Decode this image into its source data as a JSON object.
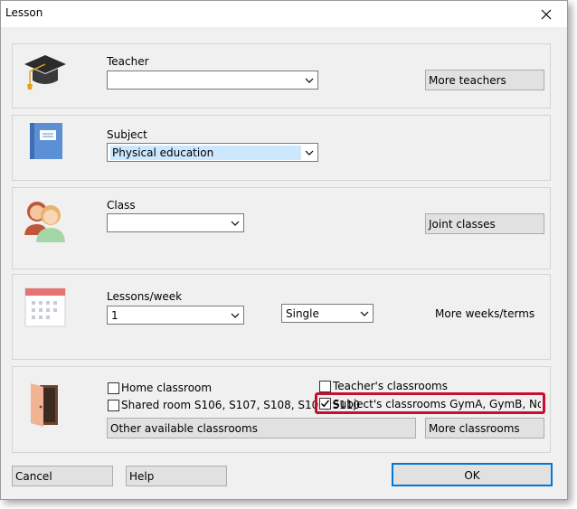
{
  "window": {
    "title": "Lesson"
  },
  "teacher": {
    "label": "Teacher",
    "value": "",
    "more_button": "More teachers"
  },
  "subject": {
    "label": "Subject",
    "value": "Physical education"
  },
  "class": {
    "label": "Class",
    "value": "",
    "joint_button": "Joint classes"
  },
  "lessons": {
    "label": "Lessons/week",
    "count": "1",
    "type": "Single",
    "more_weeks": "More weeks/terms"
  },
  "rooms": {
    "home_classroom": {
      "label": "Home classroom",
      "checked": false
    },
    "shared_room": {
      "label": "Shared room S106, S107, S108, S109, S110",
      "checked": false
    },
    "teachers_classrooms": {
      "label": "Teacher's classrooms",
      "checked": false
    },
    "subjects_classrooms": {
      "label": "Subject's classrooms GymA, GymB, Normal:Gy",
      "checked": true
    },
    "other_available": "Other available classrooms",
    "more_classrooms": "More classrooms",
    "highlight_color": "#c8102e"
  },
  "footer": {
    "cancel": "Cancel",
    "help": "Help",
    "ok": "OK"
  }
}
